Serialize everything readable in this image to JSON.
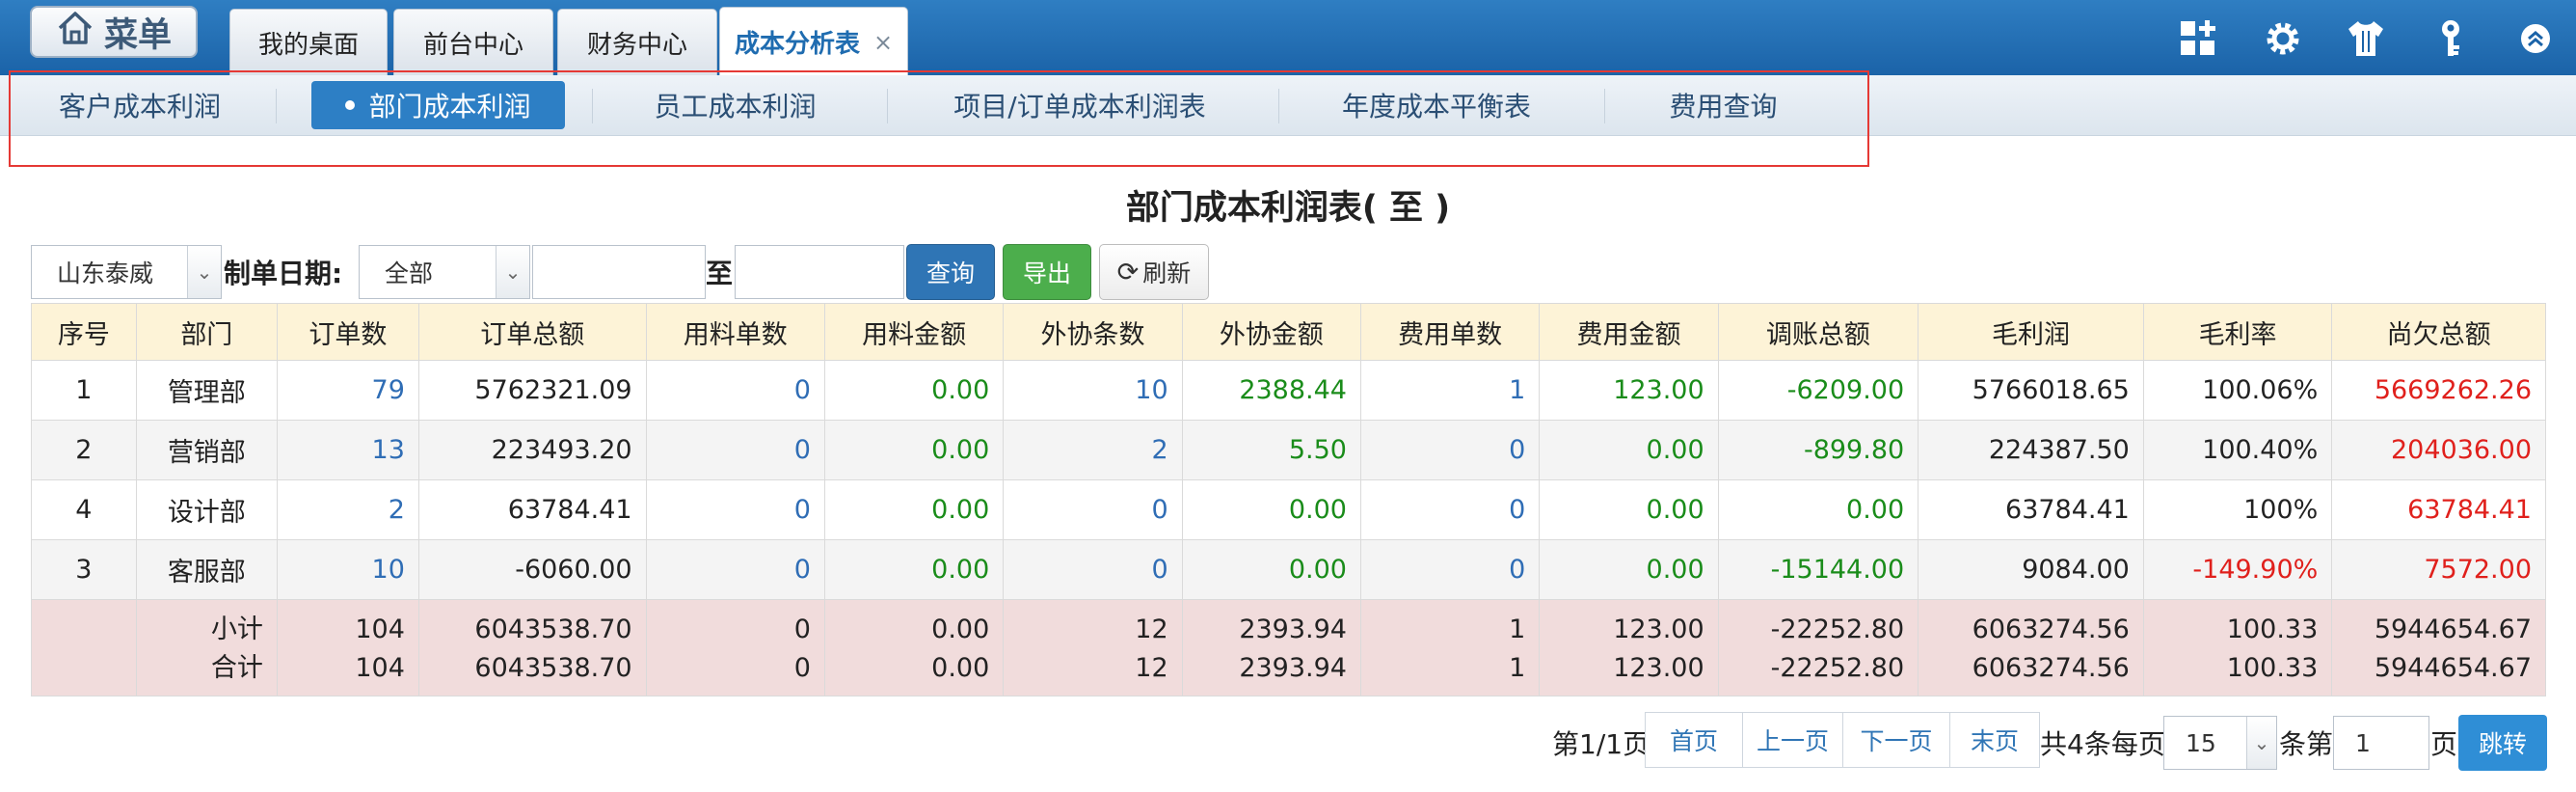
{
  "topbar": {
    "menu_label": "菜单",
    "tabs": [
      {
        "label": "我的桌面"
      },
      {
        "label": "前台中心"
      },
      {
        "label": "财务中心"
      },
      {
        "label": "成本分析表",
        "close": "×",
        "active": true
      }
    ],
    "icons": [
      "grid-add-icon",
      "gear-icon",
      "shirt-icon",
      "key-icon",
      "collapse-up-icon"
    ],
    "colors": {
      "bar": "#1b63a8",
      "accent": "#2d7fc5",
      "highlight_frame": "#e53935"
    }
  },
  "subnav": {
    "items": [
      {
        "label": "客户成本利润"
      },
      {
        "label": "部门成本利润",
        "active": true
      },
      {
        "label": "员工成本利润"
      },
      {
        "label": "项目/订单成本利润表"
      },
      {
        "label": "年度成本平衡表"
      },
      {
        "label": "费用查询"
      }
    ]
  },
  "report": {
    "title": "部门成本利润表( 至 )"
  },
  "filters": {
    "company": "山东泰威",
    "date_label": "制单日期:",
    "date_range": "全部",
    "date_from": "",
    "to_label": "至",
    "date_to": "",
    "query_btn": "查询",
    "export_btn": "导出",
    "refresh_btn": "刷新"
  },
  "table": {
    "headers": [
      "序号",
      "部门",
      "订单数",
      "订单总额",
      "用料单数",
      "用料金额",
      "外协条数",
      "外协金额",
      "费用单数",
      "费用金额",
      "调账总额",
      "毛利润",
      "毛利率",
      "尚欠总额"
    ],
    "rows": [
      [
        "1",
        "管理部",
        "79",
        "5762321.09",
        "0",
        "0.00",
        "10",
        "2388.44",
        "1",
        "123.00",
        "-6209.00",
        "5766018.65",
        "100.06%",
        "5669262.26"
      ],
      [
        "2",
        "营销部",
        "13",
        "223493.20",
        "0",
        "0.00",
        "2",
        "5.50",
        "0",
        "0.00",
        "-899.80",
        "224387.50",
        "100.40%",
        "204036.00"
      ],
      [
        "4",
        "设计部",
        "2",
        "63784.41",
        "0",
        "0.00",
        "0",
        "0.00",
        "0",
        "0.00",
        "0.00",
        "63784.41",
        "100%",
        "63784.41"
      ],
      [
        "3",
        "客服部",
        "10",
        "-6060.00",
        "0",
        "0.00",
        "0",
        "0.00",
        "0",
        "0.00",
        "-15144.00",
        "9084.00",
        "-149.90%",
        "7572.00"
      ]
    ],
    "subtotal": {
      "label": "小计",
      "values": [
        "104",
        "6043538.70",
        "0",
        "0.00",
        "12",
        "2393.94",
        "1",
        "123.00",
        "-22252.80",
        "6063274.56",
        "100.33",
        "5944654.67"
      ]
    },
    "total": {
      "label": "合计",
      "values": [
        "104",
        "6043538.70",
        "0",
        "0.00",
        "12",
        "2393.94",
        "1",
        "123.00",
        "-22252.80",
        "6063274.56",
        "100.33",
        "5944654.67"
      ]
    }
  },
  "pager": {
    "page_info": "第1/1页",
    "first": "首页",
    "prev": "上一页",
    "next": "下一页",
    "last": "末页",
    "total_info": "共4条每页",
    "page_size": "15",
    "items_label": "条第",
    "page_no": "1",
    "page_suffix": "页",
    "jump_btn": "跳转"
  }
}
